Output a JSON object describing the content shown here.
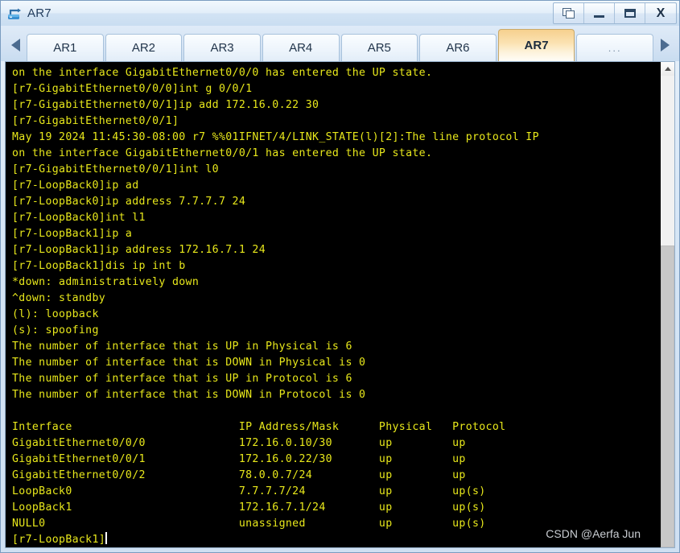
{
  "window": {
    "title": "AR7",
    "icon": "router-icon",
    "buttons": [
      {
        "name": "restore-button",
        "label": "restore",
        "glyph": "restore-icon"
      },
      {
        "name": "minimize-button",
        "label": "minimize",
        "glyph": "minimize-icon"
      },
      {
        "name": "maximize-button",
        "label": "maximize",
        "glyph": "maximize-icon"
      },
      {
        "name": "close-button",
        "label": "X",
        "glyph": "close-icon"
      }
    ]
  },
  "tabbar": {
    "scroll_left_icon": "chevron-left-icon",
    "scroll_right_icon": "chevron-right-icon",
    "active_tab": "AR7",
    "tabs": [
      {
        "label": "AR1",
        "active": false
      },
      {
        "label": "AR2",
        "active": false
      },
      {
        "label": "AR3",
        "active": false
      },
      {
        "label": "AR4",
        "active": false
      },
      {
        "label": "AR5",
        "active": false
      },
      {
        "label": "AR6",
        "active": false
      },
      {
        "label": "AR7",
        "active": true
      },
      {
        "label": "...",
        "active": false
      }
    ]
  },
  "terminal": {
    "foreground_color": "#e8e81b",
    "background_color": "#000000",
    "cursor_color": "#ffffff",
    "prompt": "[r7-LoopBack1]",
    "lines": [
      "on the interface GigabitEthernet0/0/0 has entered the UP state.",
      "[r7-GigabitEthernet0/0/0]int g 0/0/1",
      "[r7-GigabitEthernet0/0/1]ip add 172.16.0.22 30",
      "[r7-GigabitEthernet0/0/1]",
      "May 19 2024 11:45:30-08:00 r7 %%01IFNET/4/LINK_STATE(l)[2]:The line protocol IP",
      "on the interface GigabitEthernet0/0/1 has entered the UP state.",
      "[r7-GigabitEthernet0/0/1]int l0",
      "[r7-LoopBack0]ip ad",
      "[r7-LoopBack0]ip address 7.7.7.7 24",
      "[r7-LoopBack0]int l1",
      "[r7-LoopBack1]ip a",
      "[r7-LoopBack1]ip address 172.16.7.1 24",
      "[r7-LoopBack1]dis ip int b",
      "*down: administratively down",
      "^down: standby",
      "(l): loopback",
      "(s): spoofing",
      "The number of interface that is UP in Physical is 6",
      "The number of interface that is DOWN in Physical is 0",
      "The number of interface that is UP in Protocol is 6",
      "The number of interface that is DOWN in Protocol is 0",
      "",
      "Interface                         IP Address/Mask      Physical   Protocol",
      "GigabitEthernet0/0/0              172.16.0.10/30       up         up",
      "GigabitEthernet0/0/1              172.16.0.22/30       up         up",
      "GigabitEthernet0/0/2              78.0.0.7/24          up         up",
      "LoopBack0                         7.7.7.7/24           up         up(s)",
      "LoopBack1                         172.16.7.1/24        up         up(s)",
      "NULL0                             unassigned           up         up(s)"
    ],
    "interface_table": {
      "headers": [
        "Interface",
        "IP Address/Mask",
        "Physical",
        "Protocol"
      ],
      "rows": [
        [
          "GigabitEthernet0/0/0",
          "172.16.0.10/30",
          "up",
          "up"
        ],
        [
          "GigabitEthernet0/0/1",
          "172.16.0.22/30",
          "up",
          "up"
        ],
        [
          "GigabitEthernet0/0/2",
          "78.0.0.7/24",
          "up",
          "up"
        ],
        [
          "LoopBack0",
          "7.7.7.7/24",
          "up",
          "up(s)"
        ],
        [
          "LoopBack1",
          "172.16.7.1/24",
          "up",
          "up(s)"
        ],
        [
          "NULL0",
          "unassigned",
          "up",
          "up(s)"
        ]
      ]
    },
    "counters": {
      "up_physical": 6,
      "down_physical": 0,
      "up_protocol": 6,
      "down_protocol": 0
    },
    "legend": {
      "admin_down": "*down: administratively down",
      "standby": "^down: standby",
      "loopback": "(l): loopback",
      "spoofing": "(s): spoofing"
    }
  },
  "scrollbar": {
    "up_arrow_icon": "chevron-up-icon"
  },
  "watermark": {
    "text": "CSDN @Aerfa Jun"
  }
}
